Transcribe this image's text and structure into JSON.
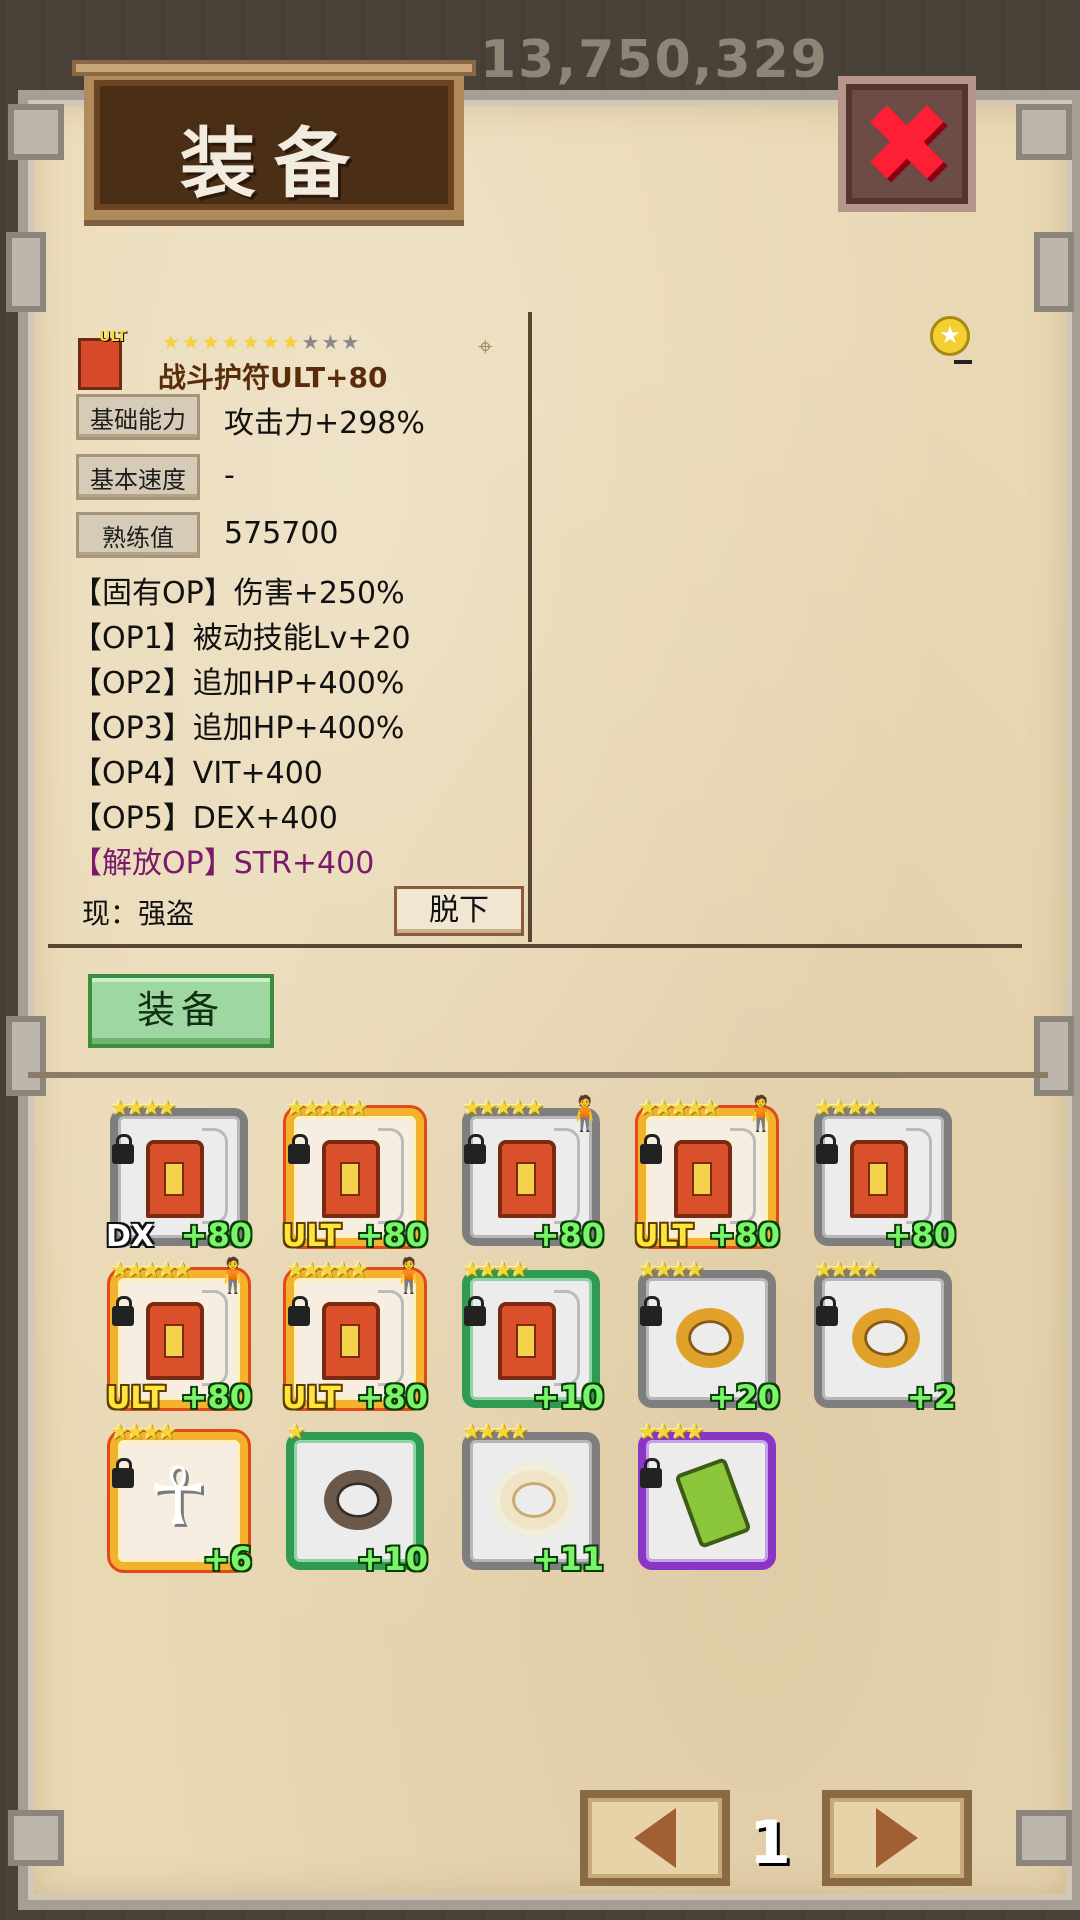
{
  "background": {
    "gold_amount": "13,750,329"
  },
  "header": {
    "title": "装备",
    "close_icon": "close-icon"
  },
  "item": {
    "name": "战斗护符ULT+80",
    "tier_badge": "ULT",
    "stars_on": "★★★★★★★",
    "stars_off": "★★★",
    "stat_labels": [
      "基础能力",
      "基本速度",
      "熟练值"
    ],
    "stat_values": [
      "攻击力+298%",
      "-",
      "575700"
    ],
    "options": [
      "【固有OP】伤害+250%",
      "【OP1】被动技能Lv+20",
      "【OP2】追加HP+400%",
      "【OP3】追加HP+400%",
      "【OP4】VIT+400",
      "【OP5】DEX+400",
      "【解放OP】STR+400"
    ],
    "current_owner": "现：强盗",
    "unequip_label": "脱下"
  },
  "actions": {
    "equip_label": "装备"
  },
  "inventory": [
    {
      "stars": "★★★★",
      "frame": "gray",
      "icon": "amulet-icon",
      "tier": "DX",
      "plus": "+80",
      "locked": true,
      "hero": ""
    },
    {
      "stars": "★★★★★",
      "frame": "redgold",
      "icon": "amulet-icon",
      "tier": "ULT",
      "plus": "+80",
      "locked": true,
      "hero": ""
    },
    {
      "stars": "★★★★★",
      "frame": "gray",
      "icon": "amulet-icon",
      "tier": "",
      "plus": "+80",
      "locked": true,
      "hero": "hero-icon"
    },
    {
      "stars": "★★★★★",
      "frame": "redgold",
      "icon": "amulet-icon",
      "tier": "ULT",
      "plus": "+80",
      "locked": true,
      "hero": "hero-icon"
    },
    {
      "stars": "★★★★",
      "frame": "gray",
      "icon": "amulet-icon",
      "tier": "",
      "plus": "+80",
      "locked": true,
      "hero": ""
    },
    {
      "stars": "★★★★★",
      "frame": "redgold",
      "icon": "amulet-icon",
      "tier": "ULT",
      "plus": "+80",
      "locked": true,
      "hero": "hero-icon"
    },
    {
      "stars": "★★★★★",
      "frame": "redgold",
      "icon": "amulet-icon",
      "tier": "ULT",
      "plus": "+80",
      "locked": true,
      "hero": "hero-icon"
    },
    {
      "stars": "★★★★",
      "frame": "green",
      "icon": "amulet-icon",
      "tier": "",
      "plus": "+10",
      "locked": true,
      "hero": ""
    },
    {
      "stars": "★★★★",
      "frame": "gray",
      "icon": "ring-icon",
      "tier": "",
      "plus": "+20",
      "locked": true,
      "hero": ""
    },
    {
      "stars": "★★★★",
      "frame": "gray",
      "icon": "ring-icon",
      "tier": "",
      "plus": "+2",
      "locked": true,
      "hero": ""
    },
    {
      "stars": "★★★★",
      "frame": "redgold",
      "icon": "ankh-icon",
      "tier": "",
      "plus": "+6",
      "locked": true,
      "hero": ""
    },
    {
      "stars": "★",
      "frame": "green",
      "icon": "dark-ring-icon",
      "tier": "",
      "plus": "+10",
      "locked": false,
      "hero": ""
    },
    {
      "stars": "★★★★",
      "frame": "gray",
      "icon": "light-ring-icon",
      "tier": "",
      "plus": "+11",
      "locked": false,
      "hero": ""
    },
    {
      "stars": "★★★★",
      "frame": "purple",
      "icon": "bottle-icon",
      "tier": "",
      "plus": "",
      "locked": true,
      "hero": ""
    }
  ],
  "pagination": {
    "page": "1"
  }
}
